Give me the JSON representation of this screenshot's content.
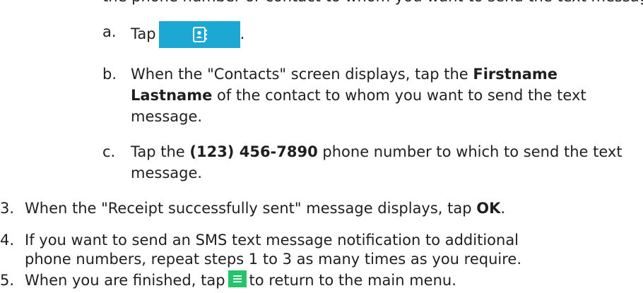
{
  "colors": {
    "contacts_button": "#1ba8d3",
    "menu_button": "#25c46a",
    "text": "#1f1f1f"
  },
  "icons": {
    "contacts": "contacts-book-icon",
    "menu": "menu-lines-icon"
  },
  "top_fragment": "the phone number or contact to whom you want to send the text message:",
  "steps": {
    "a": {
      "marker": "a.",
      "text_before": "Tap",
      "text_after": "."
    },
    "b": {
      "marker": "b.",
      "line1_pre": "When the \"Contacts\" screen displays, tap the ",
      "line1_bold": "Firstname",
      "line2_bold": "Lastname",
      "line2_post": " of the contact to whom you want to send the text",
      "line3": "message."
    },
    "c": {
      "marker": "c.",
      "line1_pre": "Tap the ",
      "line1_bold": "(123) 456-7890",
      "line1_post": " phone number to which to send the text",
      "line2": "message."
    },
    "s3": {
      "marker": "3.",
      "text_pre": "When the \"Receipt successfully sent\" message displays, tap ",
      "bold": "OK",
      "text_post": "."
    },
    "s4": {
      "marker": "4.",
      "line1": "If you want to send an SMS text message notification to additional",
      "line2": "phone numbers, repeat steps 1 to 3 as many times as you require."
    },
    "s5": {
      "marker": "5.",
      "text_pre": "When you are finished, tap",
      "text_post": "to return to the main menu."
    }
  }
}
